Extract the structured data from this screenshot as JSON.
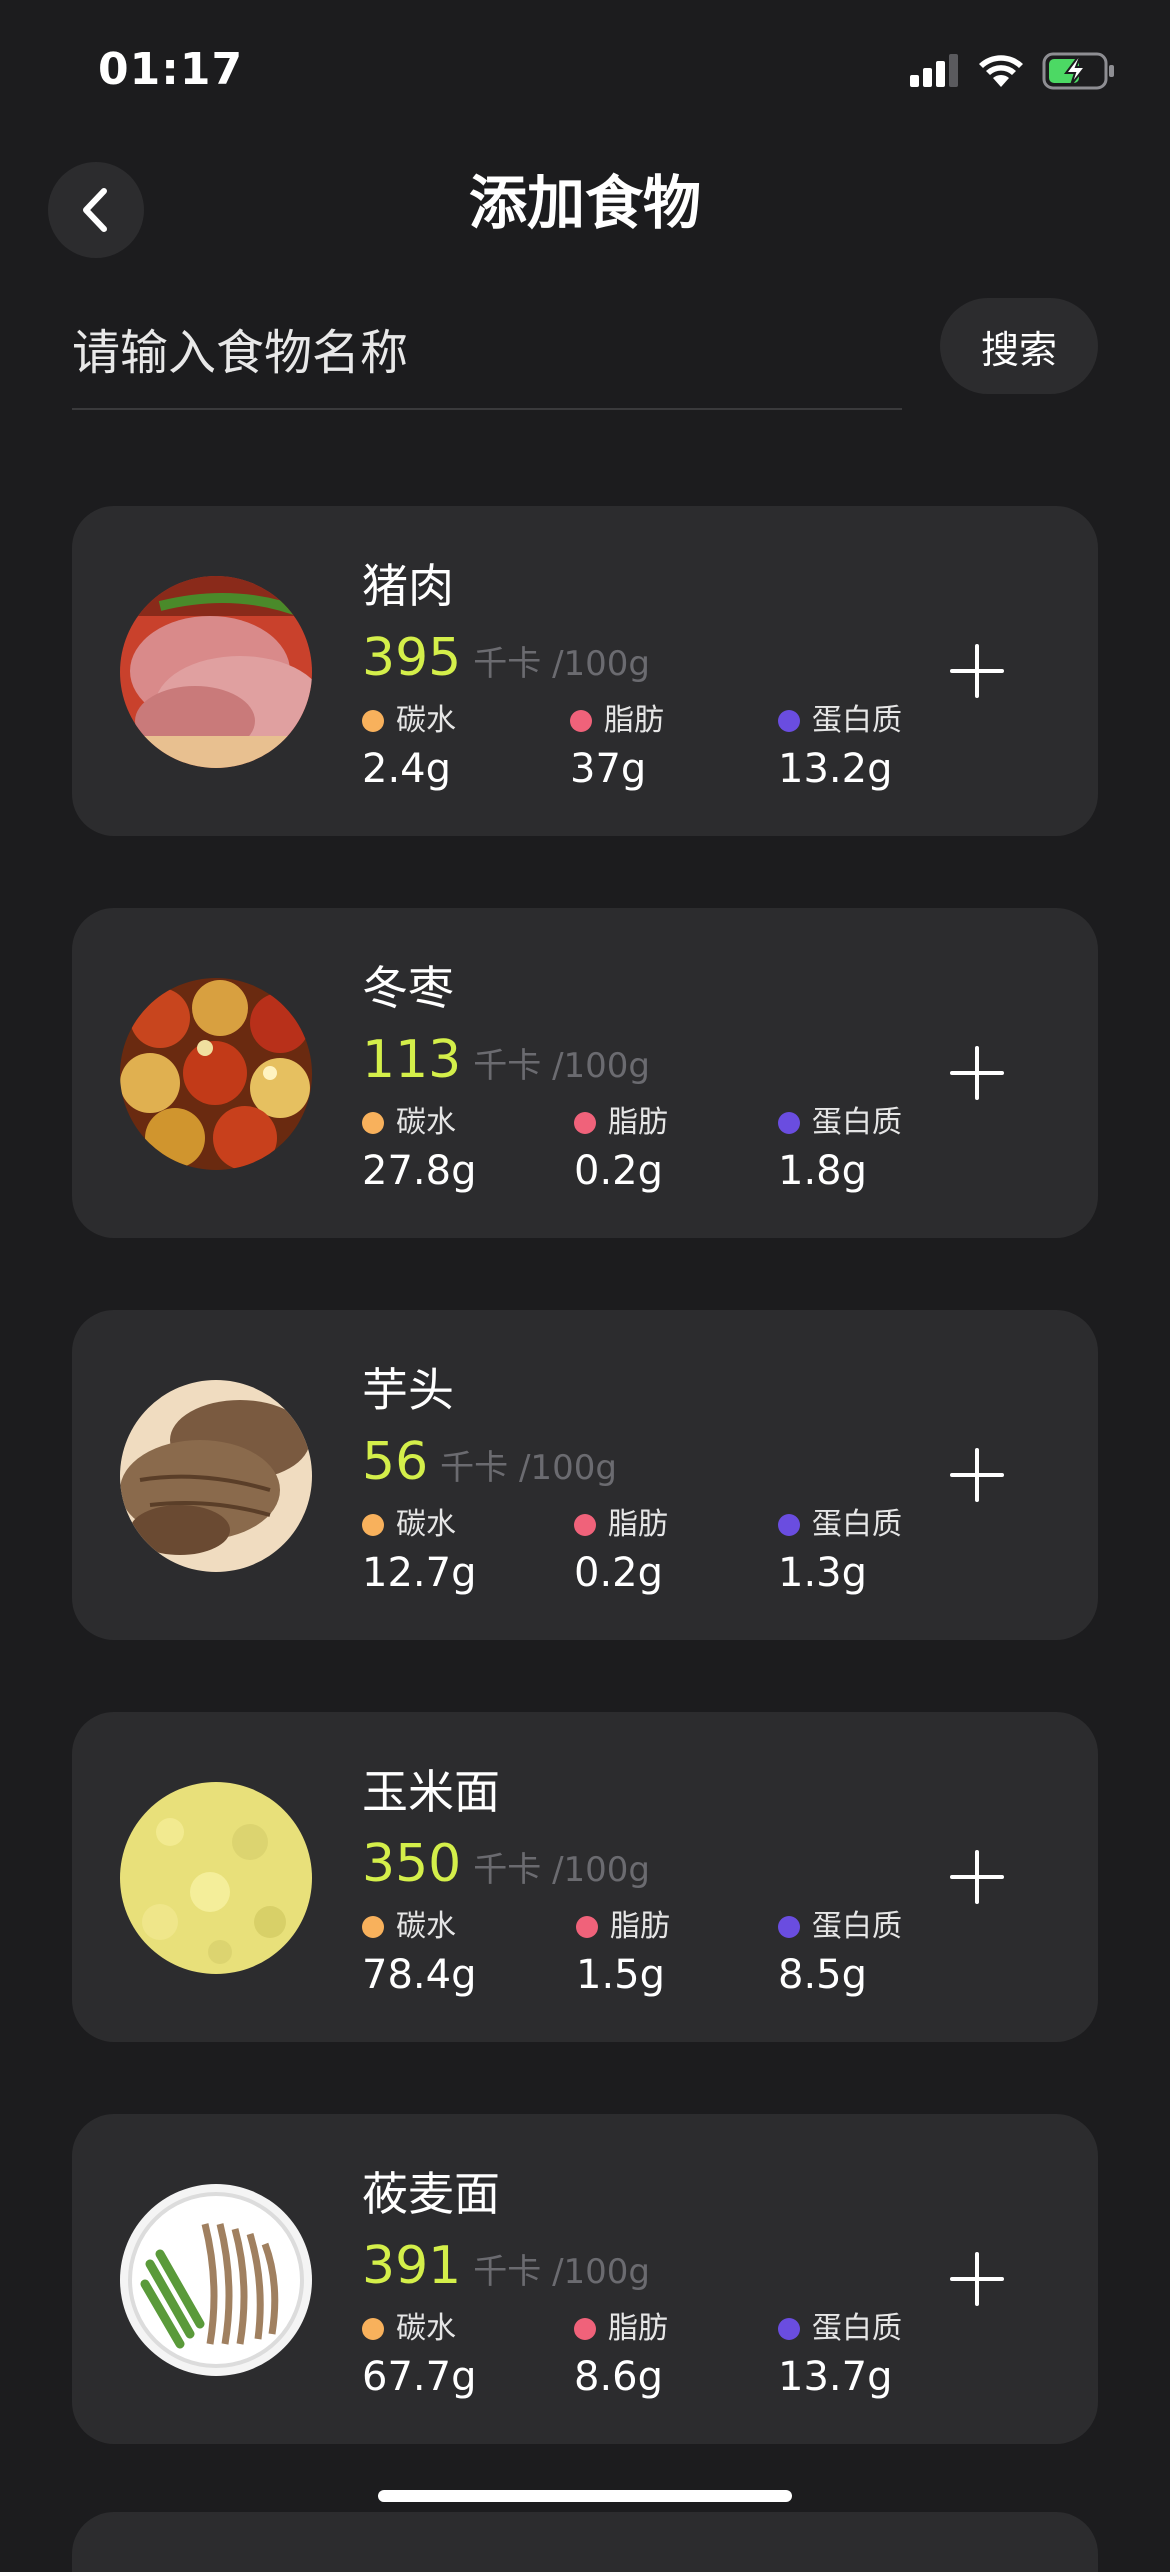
{
  "status_bar": {
    "time": "01:17"
  },
  "header": {
    "title": "添加食物"
  },
  "search": {
    "placeholder": "请输入食物名称",
    "button_label": "搜索"
  },
  "kcal_unit": "千卡 /100g",
  "nutrient_labels": {
    "carbs": "碳水",
    "fat": "脂肪",
    "protein": "蛋白质"
  },
  "colors": {
    "accent": "#d4ef4a",
    "carbs": "#f8b15c",
    "fat": "#f0627a",
    "protein": "#6a4de0",
    "card": "#2c2c2e",
    "background": "#1c1c1e"
  },
  "foods": [
    {
      "name": "猪肉",
      "kcal": "395",
      "carbs": "2.4g",
      "fat": "37g",
      "protein": "13.2g",
      "image": "pork-image"
    },
    {
      "name": "冬枣",
      "kcal": "113",
      "carbs": "27.8g",
      "fat": "0.2g",
      "protein": "1.8g",
      "image": "jujube-image"
    },
    {
      "name": "芋头",
      "kcal": "56",
      "carbs": "12.7g",
      "fat": "0.2g",
      "protein": "1.3g",
      "image": "taro-image"
    },
    {
      "name": "玉米面",
      "kcal": "350",
      "carbs": "78.4g",
      "fat": "1.5g",
      "protein": "8.5g",
      "image": "cornmeal-image"
    },
    {
      "name": "莜麦面",
      "kcal": "391",
      "carbs": "67.7g",
      "fat": "8.6g",
      "protein": "13.7g",
      "image": "oat-noodle-image"
    }
  ]
}
